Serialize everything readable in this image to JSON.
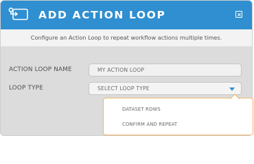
{
  "dialog": {
    "title": "ADD ACTION LOOP",
    "description": "Configure an Action Loop to repeat workflow actions multiple times."
  },
  "form": {
    "name_label": "ACTION LOOP NAME",
    "name_value": "MY ACTION LOOP",
    "type_label": "LOOP TYPE",
    "type_placeholder": "SELECT LOOP TYPE"
  },
  "dropdown": {
    "options": [
      "DATASET ROWS",
      "CONFIRM AND REPEAT"
    ]
  },
  "colors": {
    "header": "#2f8fd0",
    "accent_arrow": "#2f8fd0",
    "menu_border": "#f2b56b"
  },
  "icons": {
    "header_icon": "loop-icon",
    "close": "close-icon",
    "select_arrow": "chevron-down-icon"
  }
}
